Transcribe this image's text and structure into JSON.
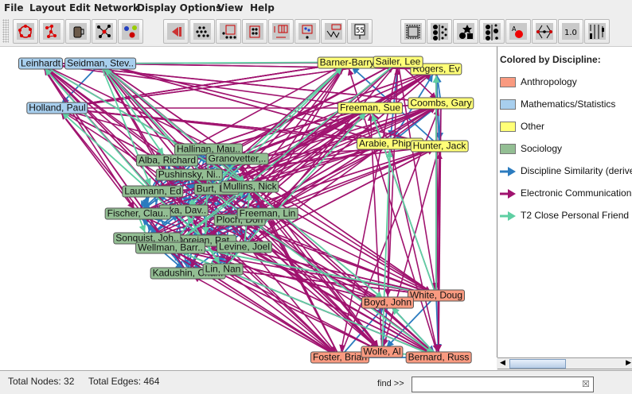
{
  "menu": [
    "File",
    "Layout",
    "Edit Network",
    "Display Options",
    "View",
    "Help"
  ],
  "toolbar": {
    "buttons": [
      "circle-layout-icon",
      "spring-layout-icon",
      "coffee-cup-icon",
      "network-highlight-icon",
      "cluster-color-icon",
      "rewind-icon",
      "scatter-nodes-icon",
      "select-region-icon",
      "node-box-icon",
      "layout-panel-icon",
      "network-options-icon",
      "subnetwork-icon",
      "sign-icon",
      "frame-icon",
      "node-size-icon",
      "node-shape-icon",
      "node-split-icon",
      "node-label-icon",
      "edge-icon",
      "value-icon",
      "bars-icon"
    ],
    "value_label": "1.0",
    "sign_label": "55"
  },
  "colors": {
    "Anthropology": "#f99a80",
    "Mathematics/Statistics": "#a8cfee",
    "Other": "#ffff77",
    "Sociology": "#93be93",
    "discipline_edge": "#2b7bbf",
    "electronic_edge": "#a0136f",
    "friend_edge": "#5fcfa3"
  },
  "nodes": [
    {
      "label": "Leinhardt",
      "group": "Mathematics/Statistics"
    },
    {
      "label": "Seidman, Stev..",
      "group": "Mathematics/Statistics"
    },
    {
      "label": "Holland, Paul",
      "group": "Mathematics/Statistics"
    },
    {
      "label": "Barner-Barry",
      "group": "Other"
    },
    {
      "label": "Rogers, Ev",
      "group": "Other"
    },
    {
      "label": "Sailer, Lee",
      "group": "Other"
    },
    {
      "label": "Freeman, Sue",
      "group": "Other"
    },
    {
      "label": "Coombs, Gary",
      "group": "Other"
    },
    {
      "label": "Arabie, Phipps",
      "group": "Other"
    },
    {
      "label": "Hunter, Jack",
      "group": "Other"
    },
    {
      "label": "Hallinan, Mau..",
      "group": "Sociology"
    },
    {
      "label": "Granovetter,..",
      "group": "Sociology"
    },
    {
      "label": "Alba, Richard",
      "group": "Sociology"
    },
    {
      "label": "Pushinsky, Ni..",
      "group": "Sociology"
    },
    {
      "label": "Burt, Ron",
      "group": "Sociology"
    },
    {
      "label": "Laumann, Ed",
      "group": "Sociology"
    },
    {
      "label": "Mullins, Nick",
      "group": "Sociology"
    },
    {
      "label": "...ka, Dav..",
      "group": "Sociology"
    },
    {
      "label": "Fischer, Clau..",
      "group": "Sociology"
    },
    {
      "label": "Ploch, Don",
      "group": "Sociology"
    },
    {
      "label": "Freeman, Lin",
      "group": "Sociology"
    },
    {
      "label": "Doreian, Pat..",
      "group": "Sociology"
    },
    {
      "label": "Sonquist, Joh..",
      "group": "Sociology"
    },
    {
      "label": "Wellman, Barr..",
      "group": "Sociology"
    },
    {
      "label": "Levine, Joel",
      "group": "Sociology"
    },
    {
      "label": "Kadushin, Char..",
      "group": "Sociology"
    },
    {
      "label": "Lin, Nan",
      "group": "Sociology"
    },
    {
      "label": "White, Doug",
      "group": "Anthropology"
    },
    {
      "label": "Boyd, John",
      "group": "Anthropology"
    },
    {
      "label": "Foster, Brian",
      "group": "Anthropology"
    },
    {
      "label": "Bernard, Russ",
      "group": "Anthropology"
    },
    {
      "label": "Wolfe, Al",
      "group": "Anthropology"
    }
  ],
  "legend": {
    "title": "Colored by Discipline:",
    "node_items": [
      "Anthropology",
      "Mathematics/Statistics",
      "Other",
      "Sociology"
    ],
    "edge_items": [
      {
        "label": "Discipline Similarity (derived)",
        "color": "#2b7bbf"
      },
      {
        "label": "Electronic Communication",
        "color": "#a0136f"
      },
      {
        "label": "T2 Close Personal Friend",
        "color": "#5fcfa3"
      }
    ]
  },
  "status": {
    "nodes_text": "Total Nodes: 32",
    "edges_text": "Total Edges: 464",
    "find_label": "find >>",
    "find_value": ""
  }
}
